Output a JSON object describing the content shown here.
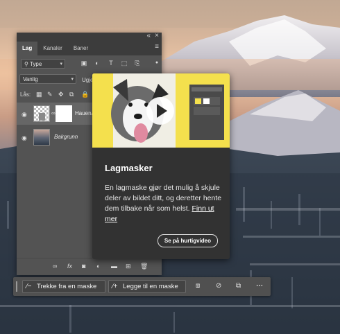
{
  "layers_panel": {
    "tabs": [
      {
        "label": "Lag"
      },
      {
        "label": "Kanaler"
      },
      {
        "label": "Baner"
      }
    ],
    "filter": {
      "label": "Type"
    },
    "blend_mode": "Vanlig",
    "opacity_label": "Ugje",
    "lock_label": "Lås:",
    "layers": [
      {
        "name": "HauenA",
        "selected": true
      },
      {
        "name": "Bakgrunn",
        "selected": false
      }
    ]
  },
  "popup": {
    "title": "Lagmasker",
    "body": "En lagmaske gjør det mulig å skjule deler av bildet ditt, og deretter hente dem tilbake når som helst.",
    "link": "Finn ut mer",
    "video_button": "Se på hurtigvideo",
    "accent_color": "#f4e04d"
  },
  "taskbar": {
    "subtract_mask": "Trekke fra en maske",
    "add_mask": "Legge til en maske",
    "more": "⋯"
  },
  "icons": {
    "collapse": "«",
    "close": "×",
    "menu": "≡",
    "eye": "👁",
    "link": "∞",
    "fx": "fx"
  }
}
